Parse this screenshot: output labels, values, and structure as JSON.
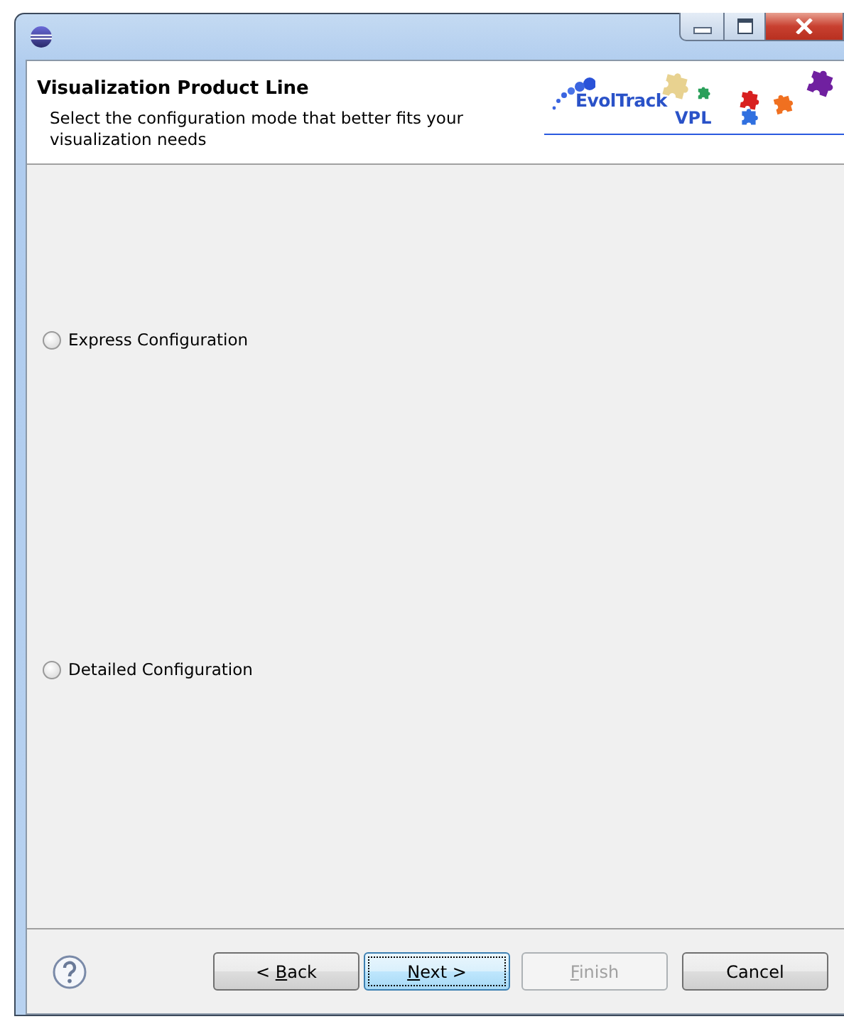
{
  "window": {
    "title_controls": [
      {
        "kind": "minimize"
      },
      {
        "kind": "maximize"
      },
      {
        "kind": "close"
      }
    ]
  },
  "header": {
    "title": "Visualization Product Line",
    "description": "Select the configuration mode that better fits your visualization needs",
    "logo": {
      "name": "EvolTrack",
      "suffix": "VPL"
    }
  },
  "options": [
    {
      "label": "Express Configuration",
      "selected": false
    },
    {
      "label": "Detailed Configuration",
      "selected": false
    }
  ],
  "buttons": [
    {
      "prefix": "< ",
      "mnemonic": "B",
      "suffix": "ack",
      "disabled": false,
      "default": false
    },
    {
      "mnemonic": "N",
      "suffix": "ext >",
      "disabled": false,
      "default": true
    },
    {
      "mnemonic": "F",
      "suffix": "inish",
      "disabled": true,
      "default": false
    },
    {
      "suffix": "Cancel",
      "disabled": false,
      "default": false
    }
  ]
}
